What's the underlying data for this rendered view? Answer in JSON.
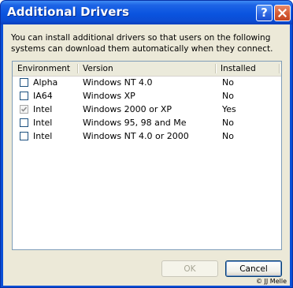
{
  "window": {
    "title": "Additional Drivers",
    "help_glyph": "?",
    "close_glyph": "✕"
  },
  "description": "You can install additional drivers so that users on the following systems can download them automatically when they connect.",
  "table": {
    "columns": [
      "Environment",
      "Version",
      "Installed"
    ],
    "rows": [
      {
        "checked": false,
        "environment": "Alpha",
        "version": "Windows NT 4.0",
        "installed": "No"
      },
      {
        "checked": false,
        "environment": "IA64",
        "version": "Windows XP",
        "installed": "No"
      },
      {
        "checked": true,
        "environment": "Intel",
        "version": "Windows 2000 or XP",
        "installed": "Yes"
      },
      {
        "checked": false,
        "environment": "Intel",
        "version": "Windows 95, 98 and Me",
        "installed": "No"
      },
      {
        "checked": false,
        "environment": "Intel",
        "version": "Windows NT 4.0 or 2000",
        "installed": "No"
      }
    ]
  },
  "buttons": {
    "ok_label": "OK",
    "ok_enabled": false,
    "cancel_label": "Cancel"
  },
  "copyright": "© JJ Melle"
}
